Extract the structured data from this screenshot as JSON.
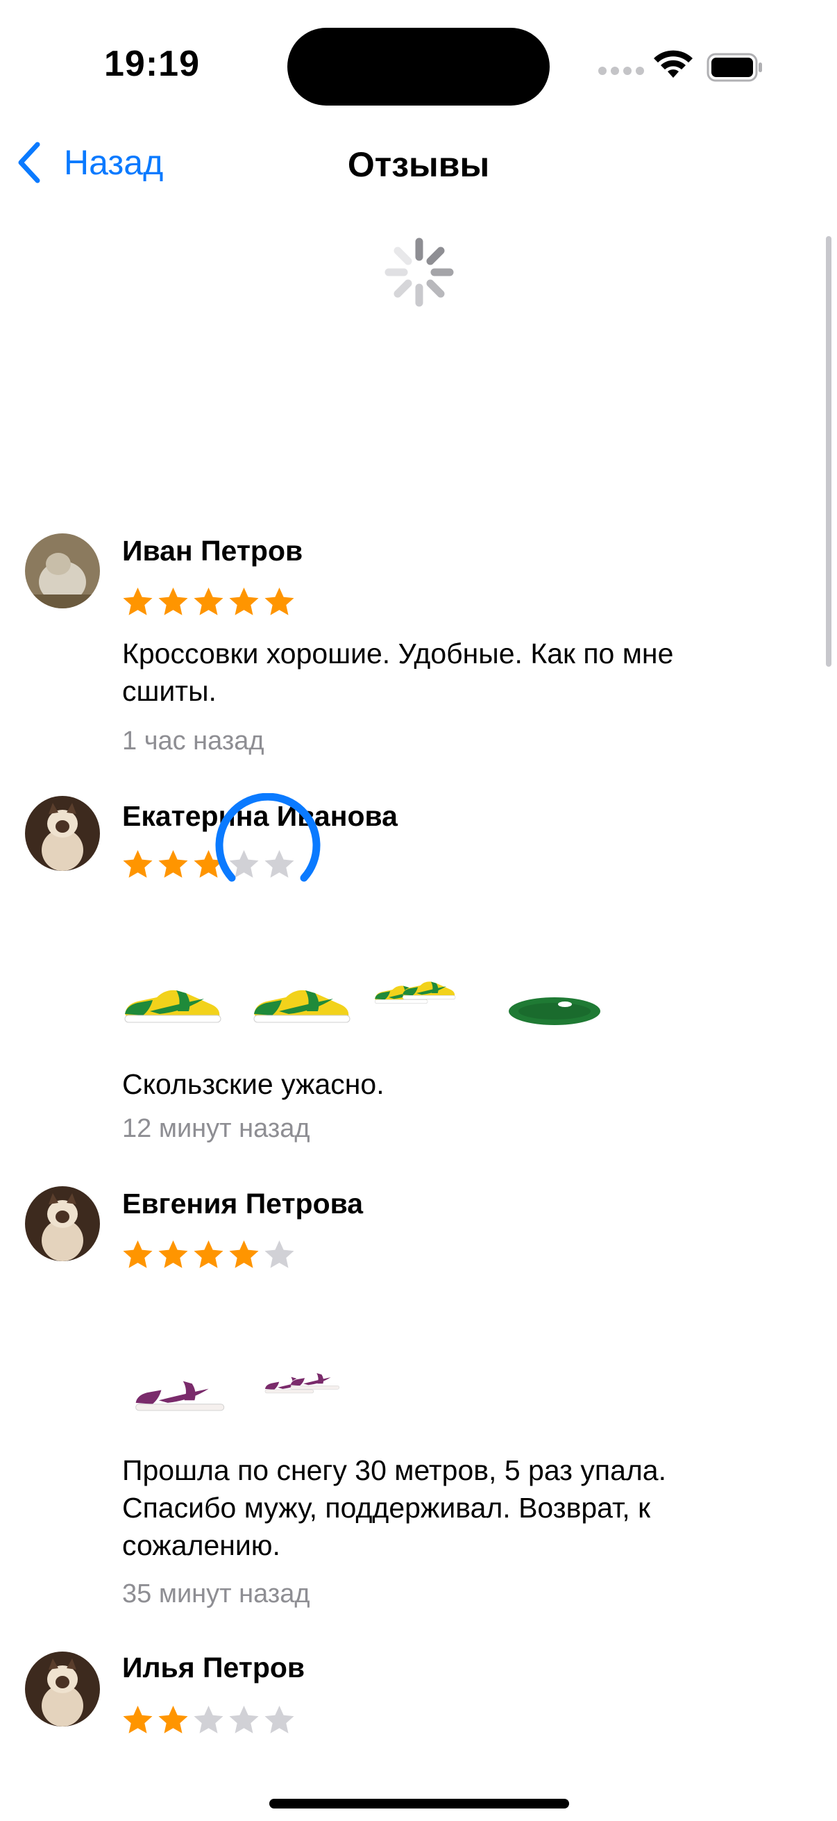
{
  "status_bar": {
    "time": "19:19"
  },
  "nav": {
    "back_label": "Назад",
    "title": "Отзывы"
  },
  "colors": {
    "accent": "#0a7aff",
    "star_on": "#ff9500",
    "star_off": "#d1d1d6",
    "secondary_text": "#8e8e93"
  },
  "reviews": [
    {
      "name": "Иван Петров",
      "rating": 5,
      "text": "Кроссовки хорошие. Удобные. Как по мне сшиты.",
      "time": "1 час назад",
      "photos": []
    },
    {
      "name": "Екатерина Иванова",
      "rating": 3,
      "text": "Скользские ужасно.",
      "time": "12 минут назад",
      "photos": [
        "sneaker-green-yellow-side",
        "sneaker-green-yellow-side",
        "sneaker-green-yellow-pair",
        "sneaker-green-sole"
      ],
      "image_loading": true
    },
    {
      "name": "Евгения Петрова",
      "rating": 4,
      "text": "Прошла по снегу 30 метров, 5 раз упала. Спасибо мужу, поддерживал. Возврат, к сожалению.",
      "time": "35 минут назад",
      "photos": [
        "sneaker-purple-side",
        "sneaker-purple-pair"
      ]
    },
    {
      "name": "Илья Петров",
      "rating": 2,
      "text": "",
      "time": "",
      "photos": []
    }
  ]
}
